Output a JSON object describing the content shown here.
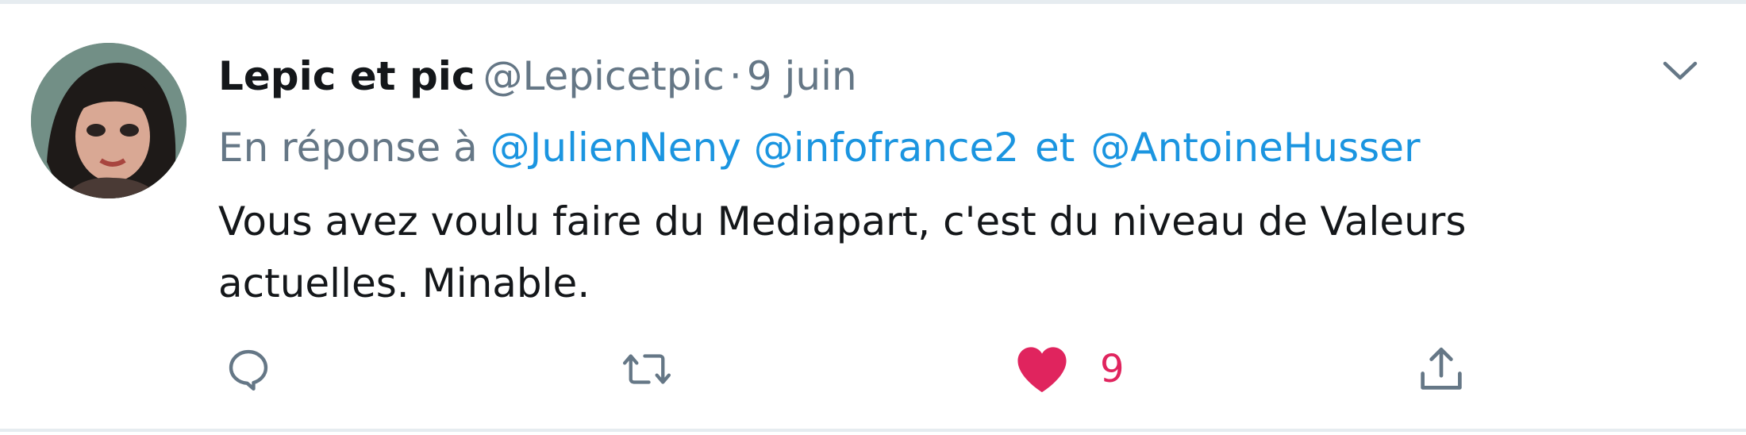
{
  "tweet": {
    "author_name": "Lepic et pic",
    "handle": "@Lepicetpic",
    "separator": "·",
    "time": "9 juin",
    "reply_prefix": "En réponse à",
    "mentions": [
      "@JulienNeny",
      "@infofrance2",
      "@AntoineHusser"
    ],
    "mention_conjunction": "et",
    "text_line1": "Vous avez voulu faire du Mediapart, c'est du niveau de Valeurs",
    "text_line2": "actuelles. Minable.",
    "likes": "9",
    "liked": true
  },
  "icons": {
    "menu": "chevron-down-icon",
    "reply": "reply-icon",
    "retweet": "retweet-icon",
    "like": "heart-icon",
    "share": "share-icon"
  },
  "colors": {
    "name": "#14171a",
    "secondary_text": "#657786",
    "link": "#1b95e0",
    "like_active": "#e0245e",
    "divider": "#e6ecf0"
  }
}
